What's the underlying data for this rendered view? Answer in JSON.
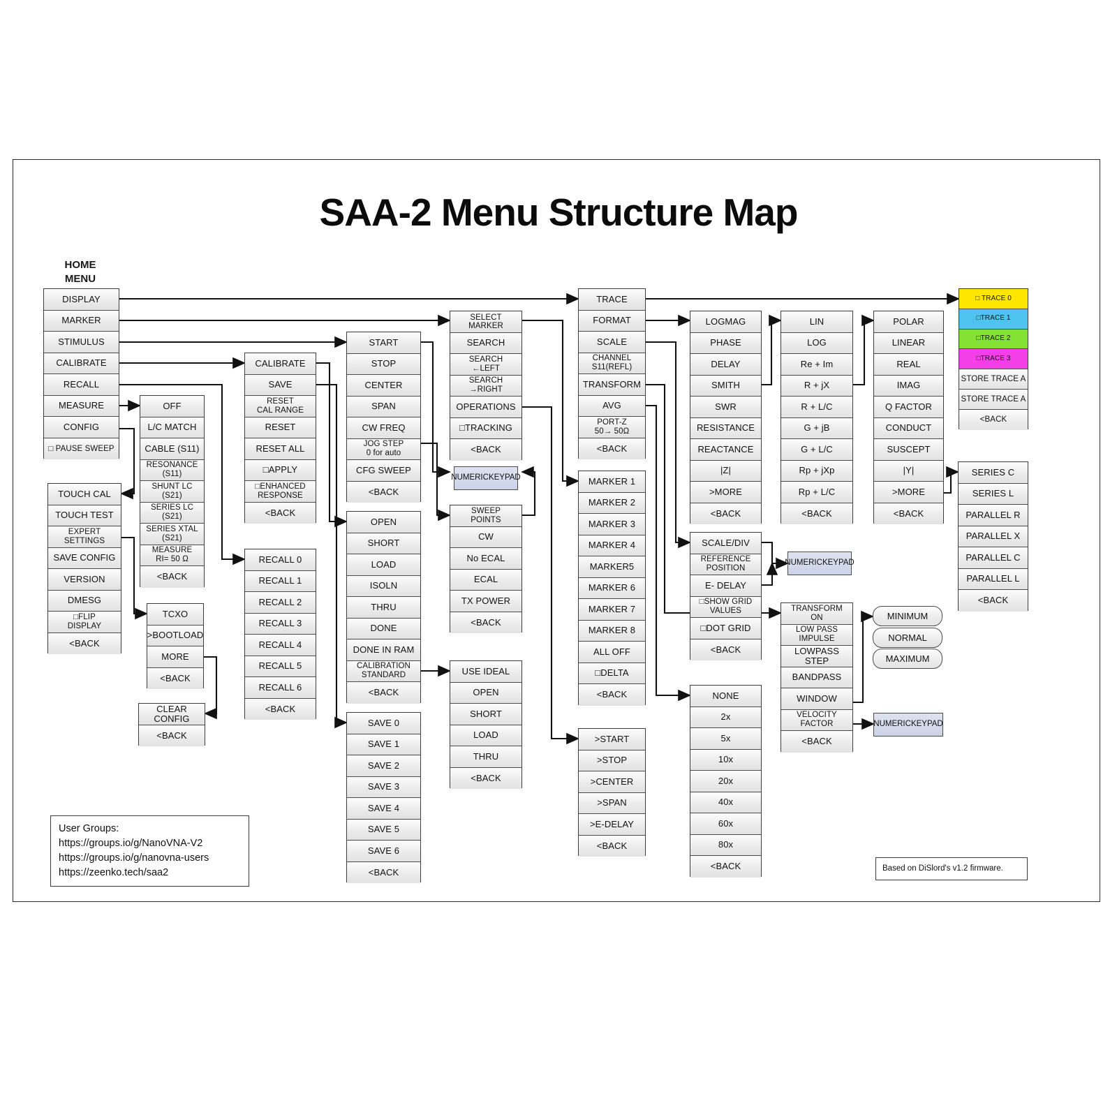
{
  "title": "SAA-2 Menu Structure Map",
  "home_label": "HOME\nMENU",
  "home_label_l1": "HOME",
  "home_label_l2": "MENU",
  "colors": {
    "trace0": "#FFE600",
    "trace1": "#4FC3F0",
    "trace2": "#82E133",
    "trace3": "#F43FE8",
    "keypad": "#ccd3e8",
    "box_border": "#3c3c3c",
    "cell_fill": "#ececec"
  },
  "columns": {
    "home": {
      "name": "home-menu",
      "items": [
        "DISPLAY",
        "MARKER",
        "STIMULUS",
        "CALIBRATE",
        "RECALL",
        "MEASURE",
        "CONFIG",
        "□ PAUSE SWEEP"
      ]
    },
    "config": {
      "name": "config-menu",
      "items": [
        "TOUCH CAL",
        "TOUCH TEST",
        "EXPERT\nSETTINGS",
        "SAVE CONFIG",
        "VERSION",
        "DMESG",
        "□FLIP\nDISPLAY",
        "<BACK"
      ]
    },
    "measure": {
      "name": "measure-menu",
      "items": [
        "OFF",
        "L/C MATCH",
        "CABLE (S11)",
        "RESONANCE\n(S11)",
        "SHUNT LC\n(S21)",
        "SERIES LC\n(S21)",
        "SERIES XTAL\n(S21)",
        "MEASURE\nRI= 50 Ω",
        "<BACK"
      ]
    },
    "expert": {
      "name": "expert-settings-menu",
      "items": [
        "TCXO",
        ">BOOTLOAD",
        "MORE",
        "<BACK"
      ]
    },
    "clear_config": {
      "name": "clear-config-menu",
      "items": [
        "CLEAR CONFIG",
        "<BACK"
      ]
    },
    "calibrate": {
      "name": "calibrate-menu",
      "items": [
        "CALIBRATE",
        "SAVE",
        "RESET\nCAL RANGE",
        "RESET",
        "RESET ALL",
        "□APPLY",
        "□ENHANCED\nRESPONSE",
        "<BACK"
      ]
    },
    "recall": {
      "name": "recall-menu",
      "items": [
        "RECALL 0",
        "RECALL 1",
        "RECALL 2",
        "RECALL 3",
        "RECALL 4",
        "RECALL 5",
        "RECALL 6",
        "<BACK"
      ]
    },
    "stimulus": {
      "name": "stimulus-menu",
      "items": [
        "START",
        "STOP",
        "CENTER",
        "SPAN",
        "CW FREQ",
        "JOG STEP\n0 for auto",
        "CFG SWEEP",
        "<BACK"
      ]
    },
    "cal_standards": {
      "name": "calibration-steps-menu",
      "items": [
        "OPEN",
        "SHORT",
        "LOAD",
        "ISOLN",
        "THRU",
        "DONE",
        "DONE IN RAM",
        "CALIBRATION\nSTANDARD",
        "<BACK"
      ]
    },
    "save": {
      "name": "save-menu",
      "items": [
        "SAVE 0",
        "SAVE 1",
        "SAVE 2",
        "SAVE 3",
        "SAVE 4",
        "SAVE 5",
        "SAVE 6",
        "<BACK"
      ]
    },
    "select_marker": {
      "name": "select-marker-menu",
      "items": [
        "SELECT MARKER",
        "SEARCH",
        "SEARCH\n←LEFT",
        "SEARCH\n→RIGHT",
        "OPERATIONS",
        "□TRACKING",
        "<BACK"
      ]
    },
    "cfg_sweep": {
      "name": "cfg-sweep-menu",
      "items": [
        "SWEEP\nPOINTS",
        "CW",
        "No ECAL",
        "ECAL",
        "TX POWER",
        "<BACK"
      ]
    },
    "use_ideal": {
      "name": "calibration-standard-menu",
      "items": [
        "USE IDEAL",
        "OPEN",
        "SHORT",
        "LOAD",
        "THRU",
        "<BACK"
      ]
    },
    "trace": {
      "name": "display-menu",
      "items": [
        "TRACE",
        "FORMAT",
        "SCALE",
        "CHANNEL\nS11(REFL)",
        "TRANSFORM",
        "AVG",
        "PORT-Z\n50→ 50Ω",
        "<BACK"
      ]
    },
    "markers": {
      "name": "marker-list-menu",
      "items": [
        "MARKER 1",
        "MARKER 2",
        "MARKER 3",
        "MARKER 4",
        "MARKER5",
        "MARKER 6",
        "MARKER 7",
        "MARKER 8",
        "ALL OFF",
        "□DELTA",
        "<BACK"
      ]
    },
    "operations": {
      "name": "marker-operations-menu",
      "items": [
        ">START",
        ">STOP",
        ">CENTER",
        ">SPAN",
        ">E-DELAY",
        "<BACK"
      ]
    },
    "format": {
      "name": "format-menu",
      "items": [
        "LOGMAG",
        "PHASE",
        "DELAY",
        "SMITH",
        "SWR",
        "RESISTANCE",
        "REACTANCE",
        "|Z|",
        ">MORE",
        "<BACK"
      ]
    },
    "scale_div": {
      "name": "scale-menu",
      "items": [
        "SCALE/DIV",
        "REFERENCE\nPOSITION",
        "E- DELAY",
        "□SHOW GRID\nVALUES",
        "□DOT GRID",
        "<BACK"
      ]
    },
    "avg": {
      "name": "avg-menu",
      "items": [
        "NONE",
        "2x",
        "5x",
        "10x",
        "20x",
        "40x",
        "60x",
        "80x",
        "<BACK"
      ]
    },
    "smith_fmt": {
      "name": "smith-format-menu",
      "items": [
        "LIN",
        "LOG",
        "Re + Im",
        "R + jX",
        "R + L/C",
        "G + jB",
        "G + L/C",
        "Rp + jXp",
        "Rp + L/C",
        "<BACK"
      ]
    },
    "more_fmt": {
      "name": "more-format-menu",
      "items": [
        "POLAR",
        "LINEAR",
        "REAL",
        "IMAG",
        "Q FACTOR",
        "CONDUCT",
        "SUSCEPT",
        "|Y|",
        ">MORE",
        "<BACK"
      ]
    },
    "series_fmt": {
      "name": "series-format-menu",
      "items": [
        "SERIES C",
        "SERIES L",
        "PARALLEL R",
        "PARALLEL X",
        "PARALLEL C",
        "PARALLEL L",
        "<BACK"
      ]
    },
    "transform": {
      "name": "transform-menu",
      "items": [
        "TRANSFORM\nON",
        "LOW PASS\nIMPULSE",
        "LOWPASS STEP",
        "BANDPASS",
        "WINDOW",
        "VELOCITY\nFACTOR",
        "<BACK"
      ]
    },
    "window": {
      "name": "window-menu",
      "items": [
        "MINIMUM",
        "NORMAL",
        "MAXIMUM"
      ]
    },
    "traces": {
      "name": "trace-select-menu",
      "items": [
        {
          "label": "□ TRACE 0",
          "color": "#FFE600"
        },
        {
          "label": "□TRACE 1",
          "color": "#4FC3F0"
        },
        {
          "label": "□TRACE 2",
          "color": "#82E133"
        },
        {
          "label": "□TRACE 3",
          "color": "#F43FE8"
        },
        {
          "label": "STORE TRACE A",
          "color": "#ffffff"
        },
        {
          "label": "STORE TRACE A",
          "color": "#ffffff"
        },
        {
          "label": "<BACK",
          "color": "#ffffff"
        }
      ]
    }
  },
  "keypads": {
    "marker": "NUMERIC\nKEYPAD",
    "scale": "NUMERIC\nKEYPAD",
    "velocity": "NUMERIC\nKEYPAD",
    "line1": "NUMERIC",
    "line2": "KEYPAD"
  },
  "notes": {
    "user_groups_title": "User Groups:",
    "user_groups_links": [
      "https://groups.io/g/NanoVNA-V2",
      "https://groups.io/g/nanovna-users",
      "https://zeenko.tech/saa2"
    ],
    "firmware": "Based on DiSlord's v1.2 firmware."
  }
}
